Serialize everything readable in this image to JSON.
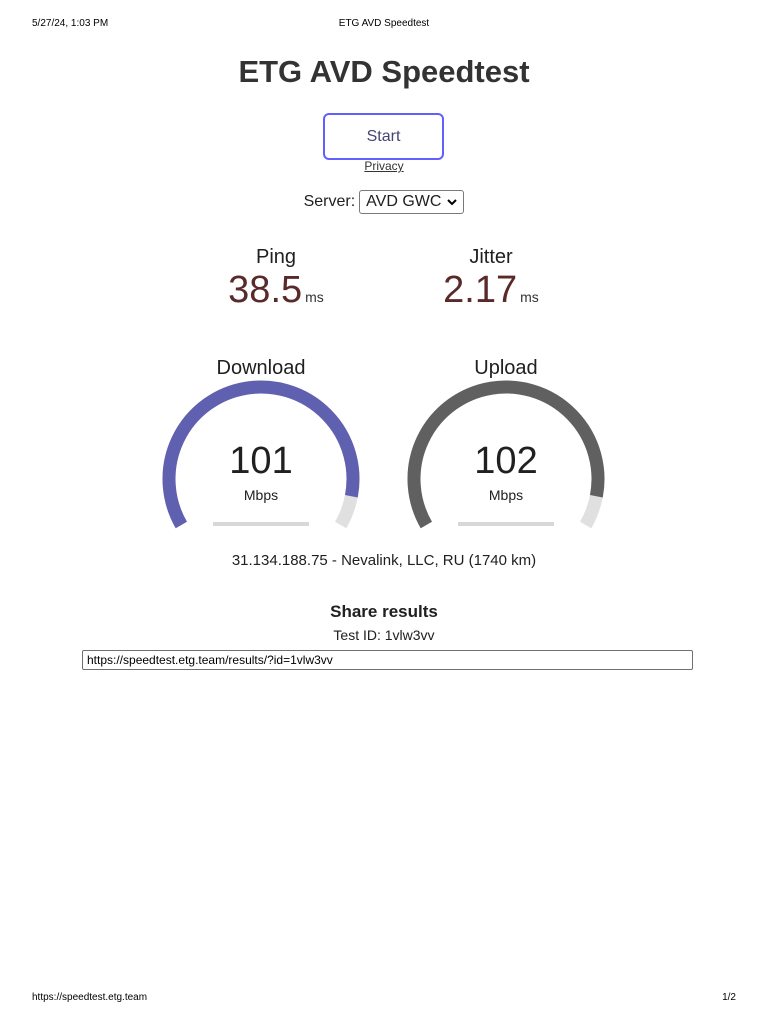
{
  "print": {
    "date": "5/27/24, 1:03 PM",
    "title": "ETG AVD Speedtest",
    "url": "https://speedtest.etg.team",
    "page": "1/2"
  },
  "header": {
    "title": "ETG AVD Speedtest"
  },
  "controls": {
    "start_label": "Start",
    "privacy_label": "Privacy",
    "server_label": "Server:",
    "server_selected": "AVD GWC"
  },
  "metrics": {
    "ping": {
      "label": "Ping",
      "value": "38.5",
      "unit": "ms"
    },
    "jitter": {
      "label": "Jitter",
      "value": "2.17",
      "unit": "ms"
    }
  },
  "gauges": {
    "download": {
      "label": "Download",
      "value": "101",
      "unit": "Mbps",
      "fill_fraction": 0.92,
      "color": "#6060b0"
    },
    "upload": {
      "label": "Upload",
      "value": "102",
      "unit": "Mbps",
      "fill_fraction": 0.92,
      "color": "#606060"
    }
  },
  "ip_info": "31.134.188.75 - Nevalink, LLC, RU (1740 km)",
  "share": {
    "title": "Share results",
    "test_id": "Test ID: 1vlw3vv",
    "url": "https://speedtest.etg.team/results/?id=1vlw3vv"
  },
  "colors": {
    "accent": "#6060ff",
    "value_text": "#5a2a2a",
    "gauge_track": "#e0e0e0"
  }
}
